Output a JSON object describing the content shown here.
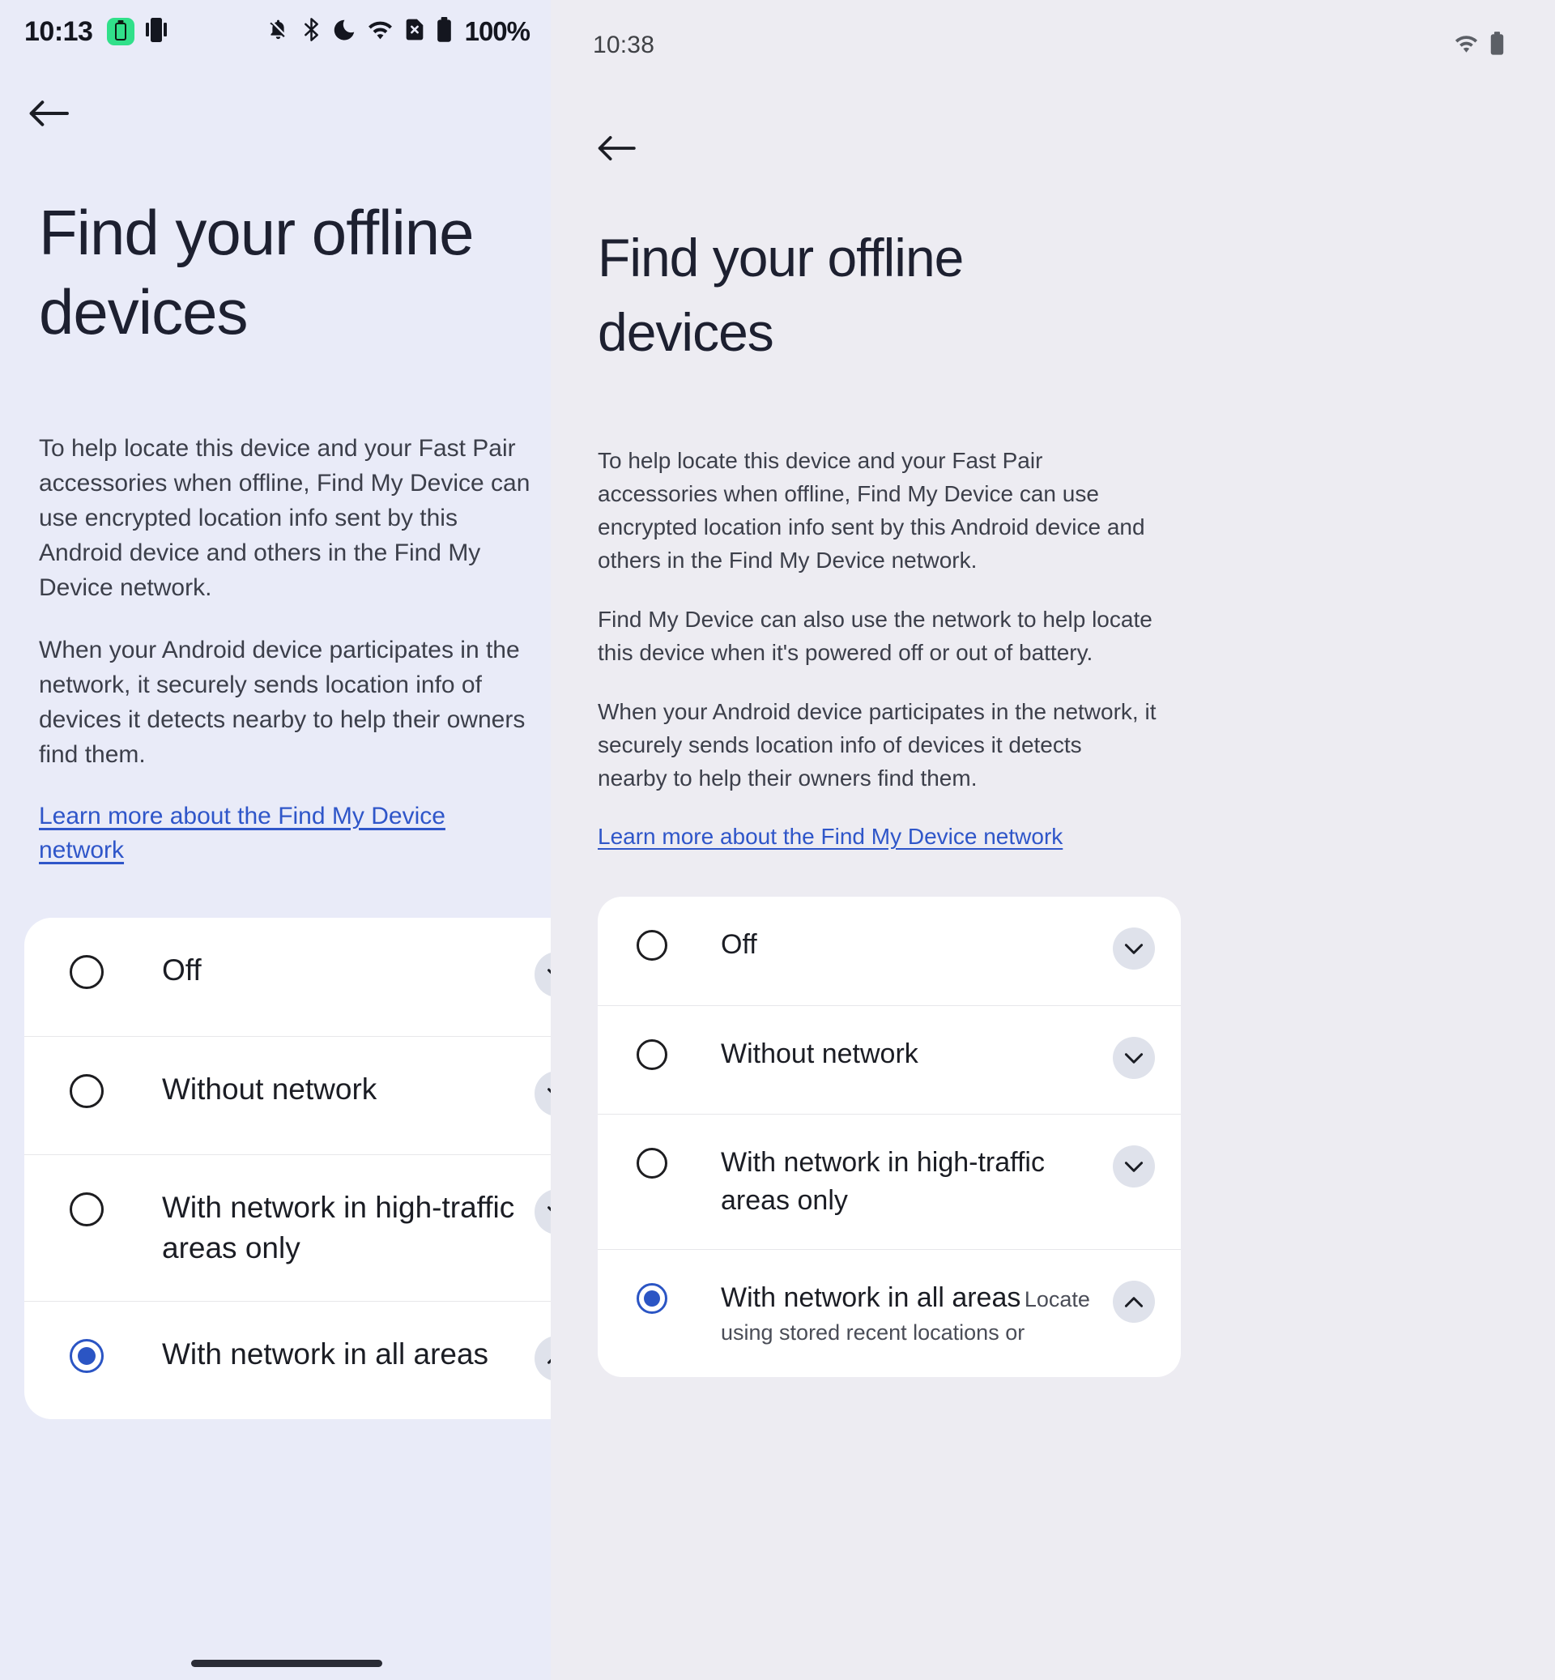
{
  "left_phone": {
    "status_bar": {
      "clock": "10:13",
      "battery_percent": "100%",
      "icons": [
        "battery-saver-badge-icon",
        "device-icon",
        "mute-icon",
        "bluetooth-icon",
        "do-not-disturb-moon-icon",
        "wifi-icon",
        "no-sim-icon",
        "battery-icon"
      ]
    },
    "back_label": "Back",
    "title": "Find your offline devices",
    "paragraphs": [
      "To help locate this device and your Fast Pair accessories when offline, Find My Device can use encrypted location info sent by this Android device and others in the Find My Device network.",
      "When your Android device participates in the network, it securely sends location info of devices it detects nearby to help their owners find them."
    ],
    "learn_more": "Learn more about the Find My Device network",
    "options": [
      {
        "label": "Off",
        "selected": false,
        "chevron": "chevron-down-icon",
        "sub": ""
      },
      {
        "label": "Without network",
        "selected": false,
        "chevron": "chevron-down-icon",
        "sub": ""
      },
      {
        "label": "With network in high-traffic areas only",
        "selected": false,
        "chevron": "chevron-down-icon",
        "sub": ""
      },
      {
        "label": "With network in all areas",
        "selected": true,
        "chevron": "chevron-up-icon",
        "sub": ""
      }
    ]
  },
  "right_phone": {
    "status_bar": {
      "clock": "10:38",
      "icons": [
        "wifi-icon",
        "battery-icon"
      ]
    },
    "back_label": "Back",
    "title": "Find your offline devices",
    "paragraphs": [
      "To help locate this device and your Fast Pair accessories when offline, Find My Device can use encrypted location info sent by this Android device and others in the Find My Device network.",
      "Find My Device can also use the network to help locate this device when it's powered off or out of battery.",
      "When your Android device participates in the network, it securely sends location info of devices it detects nearby to help their owners find them."
    ],
    "learn_more": "Learn more about the Find My Device network",
    "options": [
      {
        "label": "Off",
        "selected": false,
        "chevron": "chevron-down-icon",
        "sub": ""
      },
      {
        "label": "Without network",
        "selected": false,
        "chevron": "chevron-down-icon",
        "sub": ""
      },
      {
        "label": "With network in high-traffic areas only",
        "selected": false,
        "chevron": "chevron-down-icon",
        "sub": ""
      },
      {
        "label": "With network in all areas",
        "selected": true,
        "chevron": "chevron-up-icon",
        "sub": "Locate using stored recent locations or"
      }
    ]
  },
  "colors": {
    "left_background": "#e9ebf8",
    "right_background": "#edecf2",
    "card_background": "#ffffff",
    "link": "#2f56c9",
    "selected_radio": "#2b55c4",
    "title_text": "#1d2030",
    "body_text": "#3c3f4a",
    "chevron_button": "#dfe2eb",
    "battery_saver_badge": "#31e08a"
  }
}
